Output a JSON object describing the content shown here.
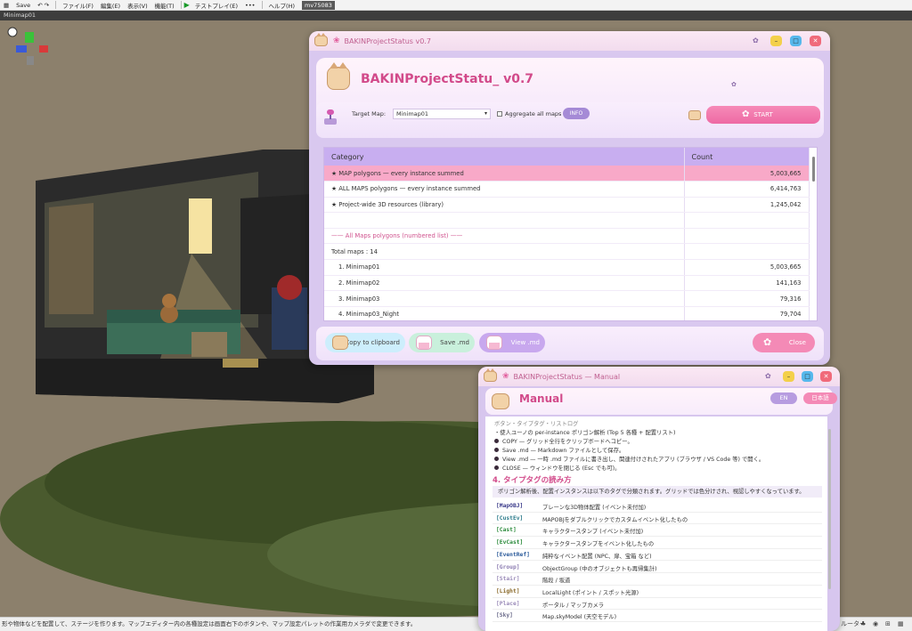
{
  "editor": {
    "menu": [
      "Save",
      "ファイル(F)",
      "編集(E)",
      "表示(V)",
      "機能(T)",
      "テストプレイ(E)",
      "•••",
      "ヘルプ(H)",
      "mv75083"
    ],
    "map_title": "Minimap01",
    "status_text": "形や物体などを配置して、ステージを作ります。マップエディター内の各種設定は画面右下のボタンや、マップ設定パレットの作業用カメラダで変更できます。",
    "status_right": "ルーター"
  },
  "status_window": {
    "title": "BAKINProjectStatus v0.7",
    "app_title": "BAKINProjectStatu_ v0.7",
    "target_map_label": "Target Map:",
    "target_map_value": "Minimap01",
    "aggregate_label": "Aggregate all maps",
    "info_label": "INFO",
    "start_label": "START",
    "table": {
      "headers": [
        "Category",
        "Count"
      ],
      "rows": [
        {
          "category": "★ MAP polygons — every instance summed",
          "count": "5,003,665",
          "style": "sel"
        },
        {
          "category": "★ ALL MAPS polygons — every instance summed",
          "count": "6,414,763",
          "style": ""
        },
        {
          "category": "★ Project-wide 3D resources (library)",
          "count": "1,245,042",
          "style": ""
        },
        {
          "category": "",
          "count": "",
          "style": ""
        },
        {
          "category": "—— All Maps polygons (numbered list) ——",
          "count": "",
          "style": "sub"
        },
        {
          "category": "Total maps : 14",
          "count": "",
          "style": ""
        },
        {
          "category": "1. Minimap01",
          "count": "5,003,665",
          "style": "idx"
        },
        {
          "category": "2. Minimap02",
          "count": "141,163",
          "style": "idx"
        },
        {
          "category": "3. Minimap03",
          "count": "79,316",
          "style": "idx"
        },
        {
          "category": "4. Minimap03_Night",
          "count": "79,704",
          "style": "idx"
        }
      ]
    },
    "buttons": {
      "copy": "Copy to clipboard",
      "save": "Save .md",
      "view": "View .md",
      "close": "Close"
    }
  },
  "manual_window": {
    "title": "BAKINProjectStatus — Manual",
    "heading": "Manual",
    "lang_en": "EN",
    "lang_ja": "日本語",
    "lines": [
      {
        "text": "ボタン・タイプタグ・リストログ",
        "faded": true,
        "dot": false
      },
      {
        "text": "・使人ユーノの per-instance ポリゴン解析 (Top 5 各種 + 配置リスト)",
        "faded": false,
        "dot": false
      },
      {
        "text": "COPY — グリッド全行をクリップボードへコピー。",
        "faded": false,
        "dot": true
      },
      {
        "text": "Save .md — Markdown ファイルとして保存。",
        "faded": false,
        "dot": true
      },
      {
        "text": "View .md — 一時 .md ファイルに書き出し、関連付けされたアプリ (ブラウザ / VS Code 等) で開く。",
        "faded": false,
        "dot": true
      },
      {
        "text": "CLOSE — ウィンドウを閉じる (Esc でも可)。",
        "faded": false,
        "dot": true
      }
    ],
    "section_title": "4. タイプタグの読み方",
    "section_note": "ポリゴン解析後、配置インスタンスは以下のタグで分類されます。グリッドでは色分けされ、視認しやすくなっています。",
    "tags": [
      {
        "tag": "[MapOBJ]",
        "desc": "プレーンな3D物体配置 (イベント未付加)",
        "color": "#3a3a8a"
      },
      {
        "tag": "[CustEv]",
        "desc": "MAPOBJをダブルクリックでカスタムイベント化したもの",
        "color": "#2a7a8a"
      },
      {
        "tag": "[Cast]",
        "desc": "キャラクタースタンプ (イベント未付加)",
        "color": "#2a8a3a"
      },
      {
        "tag": "[EvCast]",
        "desc": "キャラクタースタンプをイベント化したもの",
        "color": "#2a8a3a"
      },
      {
        "tag": "[EventRef]",
        "desc": "純粋なイベント配置 (NPC、扉、宝箱 など)",
        "color": "#2a5a9a"
      },
      {
        "tag": "[Group]",
        "desc": "ObjectGroup (中のオブジェクトも再帰集計)",
        "color": "#8a7ab0"
      },
      {
        "tag": "[Stair]",
        "desc": "階段 / 坂道",
        "color": "#9a8ab8"
      },
      {
        "tag": "[Light]",
        "desc": "LocalLight (ポイント / スポット光源)",
        "color": "#8a6a2a"
      },
      {
        "tag": "[Place]",
        "desc": "ポータル / マップカメラ",
        "color": "#9a8ab8"
      },
      {
        "tag": "[Sky]",
        "desc": "Map.skyModel (天空モデル)",
        "color": "#6a6a8a"
      }
    ]
  },
  "colors": {
    "accent_pink": "#d24a8a",
    "header_purple": "#c8aef0",
    "selected_row": "#f8a9c8"
  }
}
